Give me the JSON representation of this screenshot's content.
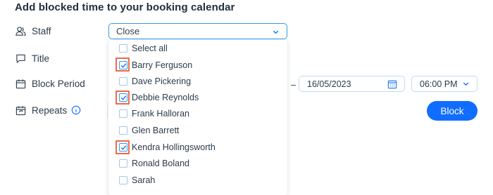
{
  "heading": "Add blocked time to your booking calendar",
  "fields": {
    "staff": "Staff",
    "title": "Title",
    "block_period": "Block Period",
    "repeats": "Repeats"
  },
  "staff_select": {
    "value": "Close"
  },
  "dropdown": {
    "options": [
      {
        "label": "Select all",
        "checked": false
      },
      {
        "label": "Barry Ferguson",
        "checked": true
      },
      {
        "label": "Dave Pickering",
        "checked": false
      },
      {
        "label": "Debbie Reynolds",
        "checked": true
      },
      {
        "label": "Frank Halloran",
        "checked": false
      },
      {
        "label": "Glen Barrett",
        "checked": false
      },
      {
        "label": "Kendra Hollingsworth",
        "checked": true
      },
      {
        "label": "Ronald Boland",
        "checked": false
      },
      {
        "label": "Sarah",
        "checked": false
      }
    ]
  },
  "block_period": {
    "separator": "–",
    "end_date": "16/05/2023",
    "end_time": "06:00 PM"
  },
  "block_button": "Block",
  "colors": {
    "accent": "#116dff",
    "highlight": "#ec6a4c",
    "checkbox": "#3899ec"
  },
  "icons": [
    "staff-icon",
    "title-icon",
    "calendar-icon",
    "repeat-icon",
    "info-icon",
    "chevron-down-icon",
    "calendar-picker-icon",
    "check-icon"
  ]
}
